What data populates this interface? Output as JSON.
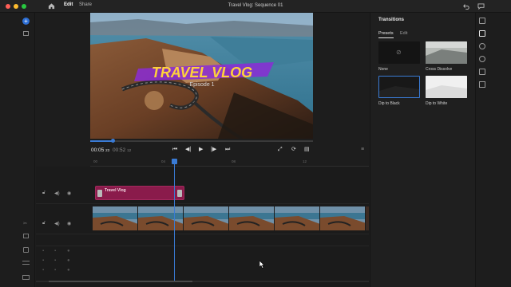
{
  "window": {
    "title": "Travel Vlog: Sequence 01",
    "tabs": [
      {
        "label": "Edit",
        "active": true
      },
      {
        "label": "Share",
        "active": false
      }
    ]
  },
  "monitor": {
    "overlay_title": "TRAVEL VLOG",
    "overlay_subtitle": "Episode 1",
    "current_time": "00:05",
    "current_frames": "23",
    "total_time": "00:52",
    "total_frames": "12",
    "playback_progress": 0.1
  },
  "timeline": {
    "ruler_labels": [
      "00",
      "04",
      "08",
      "12"
    ],
    "title_clip_label": "Travel Vlog"
  },
  "transitions_panel": {
    "title": "Transitions",
    "tabs": [
      {
        "label": "Presets",
        "active": true
      },
      {
        "label": "Edit",
        "active": false
      }
    ],
    "items": [
      {
        "label": "None",
        "selected": false
      },
      {
        "label": "Cross Dissolve",
        "selected": false
      },
      {
        "label": "Dip to Black",
        "selected": true
      },
      {
        "label": "Dip to White",
        "selected": false
      }
    ]
  },
  "colors": {
    "accent": "#3a7bd5",
    "title_clip": "#8a1b4b",
    "overlay_text": "#ffd23a",
    "overlay_brush": "#8b2bd6"
  },
  "icons": {
    "add": "plus-icon",
    "home": "home-icon",
    "media": "media-icon",
    "undo": "undo-icon",
    "feedback": "comment-icon",
    "lock": "lock-icon",
    "volume": "speaker-icon",
    "visibility": "eye-icon",
    "mic": "mic-icon"
  }
}
